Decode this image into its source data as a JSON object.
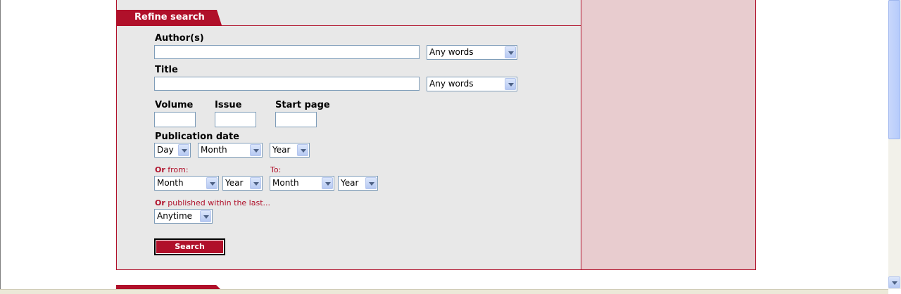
{
  "refine": {
    "tab_label": "Refine search",
    "author_label": "Author(s)",
    "author_value": "",
    "author_match": "Any words",
    "title_label": "Title",
    "title_value": "",
    "title_match": "Any words",
    "volume_label": "Volume",
    "issue_label": "Issue",
    "start_page_label": "Start page",
    "pubdate_label": "Publication date",
    "day": "Day",
    "month": "Month",
    "year": "Year",
    "or_word": "Or",
    "from_label": " from:",
    "to_label": "To:",
    "from_month": "Month",
    "from_year": "Year",
    "to_month": "Month",
    "to_year": "Year",
    "within_label": " published within the last...",
    "within_value": "Anytime",
    "search_button": "Search"
  },
  "colors": {
    "accent": "#b0102a",
    "panel_bg": "#e8e8e8",
    "side_bg": "#e8cccf"
  }
}
